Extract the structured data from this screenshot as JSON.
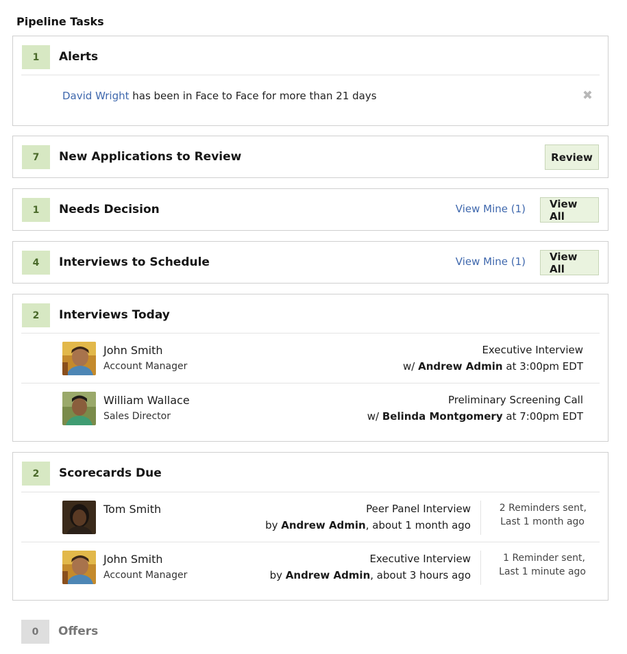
{
  "page_title": "Pipeline Tasks",
  "alerts": {
    "count": "1",
    "title": "Alerts",
    "row": {
      "person": "David Wright",
      "message": " has been in Face to Face for more than 21 days"
    },
    "close_icon": "close-icon"
  },
  "new_applications": {
    "count": "7",
    "title": "New Applications to Review",
    "button": "Review"
  },
  "needs_decision": {
    "count": "1",
    "title": "Needs Decision",
    "view_mine": "View Mine (1)",
    "view_all": "View All"
  },
  "interviews_to_schedule": {
    "count": "4",
    "title": "Interviews to Schedule",
    "view_mine": "View Mine (1)",
    "view_all": "View All"
  },
  "interviews_today": {
    "count": "2",
    "title": "Interviews Today",
    "rows": [
      {
        "name": "John Smith",
        "role": "Account Manager",
        "interview": "Executive Interview",
        "with_prefix": "w/ ",
        "interviewer": "Andrew Admin",
        "time": " at 3:00pm EDT"
      },
      {
        "name": "William Wallace",
        "role": "Sales Director",
        "interview": "Preliminary Screening Call",
        "with_prefix": "w/ ",
        "interviewer": "Belinda Montgomery",
        "time": " at 7:00pm EDT"
      }
    ]
  },
  "scorecards_due": {
    "count": "2",
    "title": "Scorecards Due",
    "rows": [
      {
        "name": "Tom Smith",
        "role": "",
        "interview": "Peer Panel Interview",
        "by_prefix": "by ",
        "interviewer": "Andrew Admin",
        "when": ", about 1 month ago",
        "reminder_line1": "2 Reminders sent,",
        "reminder_line2": "Last 1 month ago"
      },
      {
        "name": "John Smith",
        "role": "Account Manager",
        "interview": "Executive Interview",
        "by_prefix": "by ",
        "interviewer": "Andrew Admin",
        "when": ", about 3 hours ago",
        "reminder_line1": "1 Reminder sent,",
        "reminder_line2": "Last 1 minute ago"
      }
    ]
  },
  "offers": {
    "count": "0",
    "title": "Offers"
  },
  "colors": {
    "count_badge_bg": "#d7e8c3",
    "count_badge_text": "#4a6a2a",
    "link": "#3f68ad",
    "button_bg": "#eaf3df",
    "inactive_badge_bg": "#dedede"
  }
}
